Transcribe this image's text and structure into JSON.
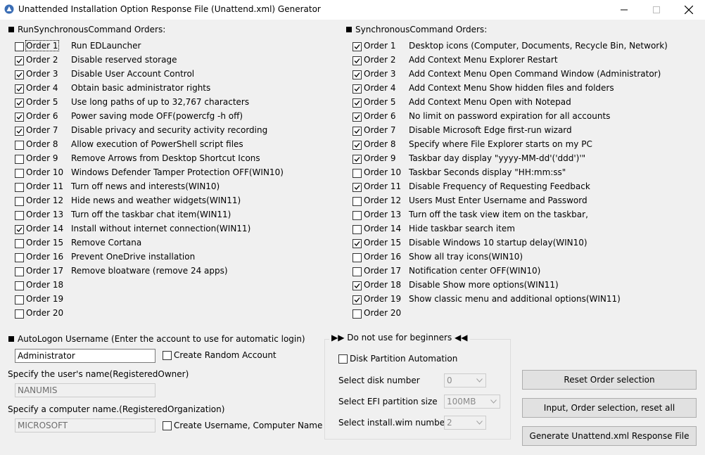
{
  "window": {
    "title": "Unattended Installation Option Response File (Unattend.xml) Generator"
  },
  "left_section": {
    "title": "RunSynchronousCommand Orders:",
    "orders": [
      {
        "label": "Order 1",
        "desc": "Run EDLauncher",
        "checked": false
      },
      {
        "label": "Order 2",
        "desc": "Disable reserved storage",
        "checked": true
      },
      {
        "label": "Order 3",
        "desc": "Disable User Account Control",
        "checked": true
      },
      {
        "label": "Order 4",
        "desc": "Obtain basic administrator rights",
        "checked": true
      },
      {
        "label": "Order 5",
        "desc": "Use long paths of up to 32,767 characters",
        "checked": true
      },
      {
        "label": "Order 6",
        "desc": "Power saving mode OFF(powercfg -h off)",
        "checked": true
      },
      {
        "label": "Order 7",
        "desc": "Disable privacy and security activity recording",
        "checked": true
      },
      {
        "label": "Order 8",
        "desc": "Allow execution of PowerShell script files",
        "checked": false
      },
      {
        "label": "Order 9",
        "desc": "Remove Arrows from Desktop Shortcut Icons",
        "checked": false
      },
      {
        "label": "Order 10",
        "desc": "Windows Defender Tamper Protection OFF(WIN10)",
        "checked": false
      },
      {
        "label": "Order 11",
        "desc": "Turn off news and interests(WIN10)",
        "checked": false
      },
      {
        "label": "Order 12",
        "desc": "Hide news and weather widgets(WIN11)",
        "checked": false
      },
      {
        "label": "Order 13",
        "desc": "Turn off the taskbar chat item(WIN11)",
        "checked": false
      },
      {
        "label": "Order 14",
        "desc": "Install without internet connection(WIN11)",
        "checked": true
      },
      {
        "label": "Order 15",
        "desc": "Remove Cortana",
        "checked": false
      },
      {
        "label": "Order 16",
        "desc": "Prevent OneDrive installation",
        "checked": false
      },
      {
        "label": "Order 17",
        "desc": "Remove bloatware (remove 24 apps)",
        "checked": false
      },
      {
        "label": "Order 18",
        "desc": "",
        "checked": false
      },
      {
        "label": "Order 19",
        "desc": "",
        "checked": false
      },
      {
        "label": "Order 20",
        "desc": "",
        "checked": false
      }
    ]
  },
  "right_section": {
    "title": "SynchronousCommand Orders:",
    "orders": [
      {
        "label": "Order 1",
        "desc": "Desktop icons (Computer, Documents, Recycle Bin, Network)",
        "checked": true
      },
      {
        "label": "Order 2",
        "desc": "Add Context Menu Explorer Restart",
        "checked": true
      },
      {
        "label": "Order 3",
        "desc": "Add Context Menu Open Command Window (Administrator)",
        "checked": true
      },
      {
        "label": "Order 4",
        "desc": "Add Context Menu Show hidden files and folders",
        "checked": true
      },
      {
        "label": "Order 5",
        "desc": "Add Context Menu Open with Notepad",
        "checked": true
      },
      {
        "label": "Order 6",
        "desc": "No limit on password expiration for all accounts",
        "checked": true
      },
      {
        "label": "Order 7",
        "desc": "Disable Microsoft Edge first-run wizard",
        "checked": true
      },
      {
        "label": "Order 8",
        "desc": "Specify where File Explorer starts on my PC",
        "checked": true
      },
      {
        "label": "Order 9",
        "desc": "Taskbar day display \"yyyy-MM-dd'('ddd')'\"",
        "checked": true
      },
      {
        "label": "Order 10",
        "desc": "Taskbar Seconds display \"HH:mm:ss\"",
        "checked": false
      },
      {
        "label": "Order 11",
        "desc": "Disable Frequency of Requesting Feedback",
        "checked": true
      },
      {
        "label": "Order 12",
        "desc": "Users Must Enter Username and Password",
        "checked": false
      },
      {
        "label": "Order 13",
        "desc": "Turn off the task view item on the taskbar,",
        "checked": false
      },
      {
        "label": "Order 14",
        "desc": "Hide taskbar search item",
        "checked": false
      },
      {
        "label": "Order 15",
        "desc": "Disable Windows 10 startup delay(WIN10)",
        "checked": true
      },
      {
        "label": "Order 16",
        "desc": "Show all tray icons(WIN10)",
        "checked": false
      },
      {
        "label": "Order 17",
        "desc": "Notification center OFF(WIN10)",
        "checked": false
      },
      {
        "label": "Order 18",
        "desc": "Disable Show more options(WIN11)",
        "checked": true
      },
      {
        "label": "Order 19",
        "desc": "Show classic menu and additional options(WIN11)",
        "checked": true
      },
      {
        "label": "Order 20",
        "desc": "",
        "checked": false
      }
    ]
  },
  "autologon": {
    "title": "AutoLogon Username (Enter the account to use for automatic login)",
    "username_value": "Administrator",
    "random_account_label": "Create Random Account",
    "random_account_checked": false
  },
  "owner": {
    "label": "Specify the user's name(RegisteredOwner)",
    "value": "NANUMIS"
  },
  "computer": {
    "label": "Specify a computer name.(RegisteredOrganization)",
    "value": "MICROSOFT",
    "create_names_label": "Create Username, Computer Name",
    "create_names_checked": false
  },
  "advanced": {
    "title": "▶▶ Do not use for beginners ◀◀",
    "disk_partition_label": "Disk Partition Automation",
    "disk_partition_checked": false,
    "disk_number_label": "Select disk number",
    "disk_number_value": "0",
    "efi_size_label": "Select EFI partition size",
    "efi_size_value": "100MB",
    "wim_number_label": "Select install.wim number",
    "wim_number_value": "2"
  },
  "buttons": {
    "reset_order": "Reset Order selection",
    "input_reset_all": "Input, Order selection, reset all",
    "generate": "Generate Unattend.xml Response File"
  }
}
